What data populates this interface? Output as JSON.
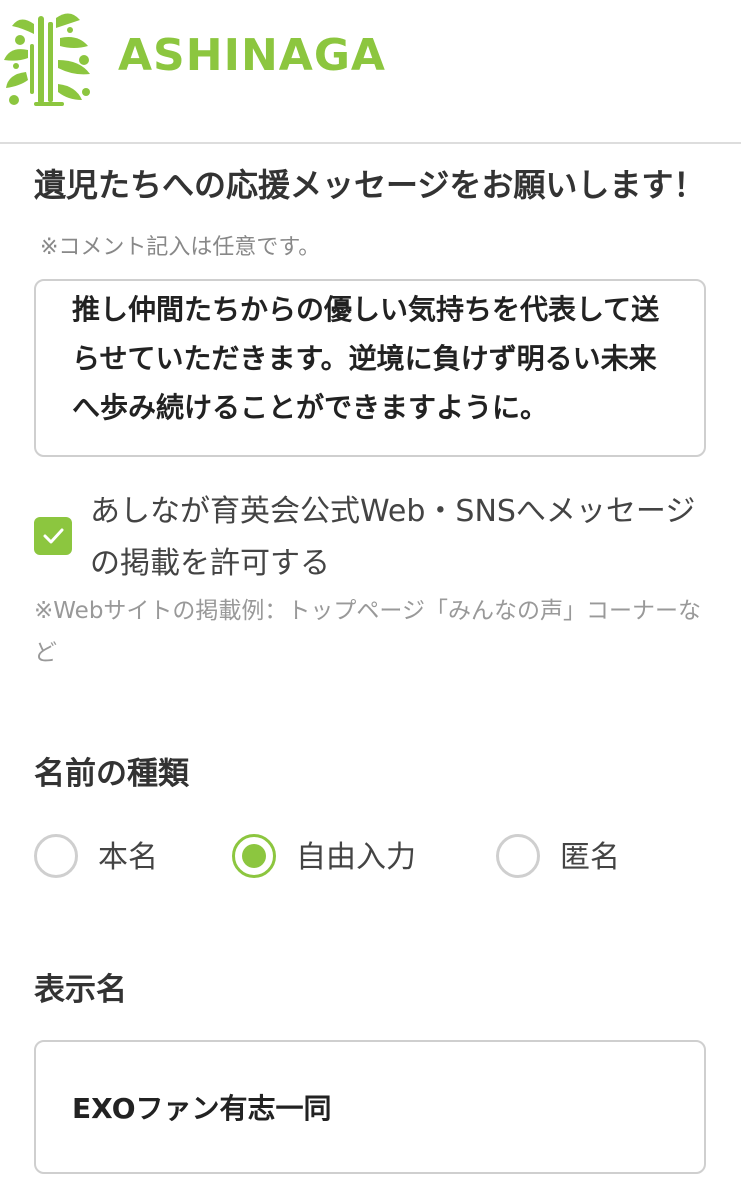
{
  "header": {
    "logo_text": "ASHINAGA",
    "brand_color": "#8cc63f"
  },
  "message_section": {
    "title": "遺児たちへの応援メッセージをお願いします！",
    "optional_note": "※コメント記入は任意です。",
    "message_value": "推し仲間たちからの優しい気持ちを代表して送らせていただきます。逆境に負けず明るい未来へ歩み続けることができますように。"
  },
  "publish_permission": {
    "checked": true,
    "label": "あしなが育英会公式Web・SNSへメッセージの掲載を許可する",
    "note": "※Webサイトの掲載例：トップページ「みんなの声」コーナーなど"
  },
  "name_type": {
    "title": "名前の種類",
    "options": [
      {
        "label": "本名",
        "selected": false
      },
      {
        "label": "自由入力",
        "selected": true
      },
      {
        "label": "匿名",
        "selected": false
      }
    ]
  },
  "display_name": {
    "title": "表示名",
    "value": "EXOファン有志一同"
  },
  "icons": {
    "logo": "ashinaga-tree-logo-icon",
    "checkbox": "checkmark-icon"
  }
}
